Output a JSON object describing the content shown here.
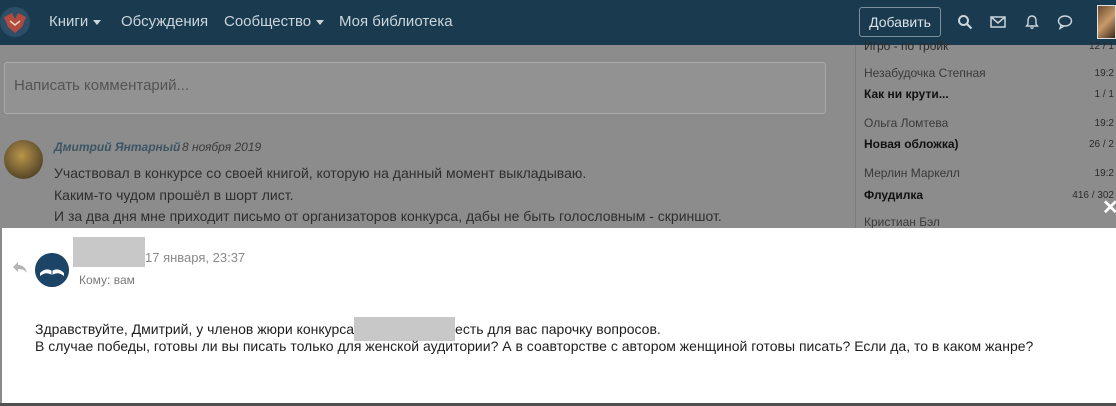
{
  "navbar": {
    "items": [
      {
        "label": "Книги",
        "has_dropdown": true
      },
      {
        "label": "Обсуждения",
        "has_dropdown": false
      },
      {
        "label": "Сообщество",
        "has_dropdown": true
      },
      {
        "label": "Моя библиотека",
        "has_dropdown": false
      }
    ],
    "add_button": "Добавить",
    "icons": [
      "search-icon",
      "mail-icon",
      "bell-icon",
      "chat-icon"
    ],
    "background_color": "#1a3a4f"
  },
  "comment_input": {
    "placeholder": "Написать комментарий..."
  },
  "post": {
    "author": "Дмитрий Янтарный",
    "date": "8 ноября 2019",
    "lines": [
      "Участвовал в конкурсе со своей книгой, которую на данный момент выкладываю.",
      "Каким-то чудом прошёл в шорт лист.",
      "И за два дня мне приходит письмо от организаторов конкурса, дабы не быть голословным - скриншот."
    ]
  },
  "sidebar": {
    "entries": [
      {
        "text": "Игро - по тройк",
        "count": "12 / 1"
      },
      {
        "text": "Незабудочка Степная",
        "count": "19:2"
      },
      {
        "text": "Как ни крути...",
        "count": "1 / 1"
      },
      {
        "text": "Ольга Ломтева",
        "count": "19:2"
      },
      {
        "text": "Новая обложка)",
        "count": "26 / 2"
      },
      {
        "text": "Мерлин Маркелл",
        "count": "19:2"
      },
      {
        "text": "Флудилка",
        "count": "416 / 302"
      },
      {
        "text": "Кристиан Бэл",
        "count": ""
      }
    ]
  },
  "message": {
    "date": "17 января, 23:37",
    "recipient": "Кому: вам",
    "line1_before": "Здравствуйте, Дмитрий, у членов жюри конкурса",
    "line1_after": "есть для вас парочку вопросов.",
    "line2": "В случае победы, готовы ли вы писать только для женской аудитории? А в соавторстве с автором женщиной готовы писать? Если да, то в каком жанре?"
  }
}
